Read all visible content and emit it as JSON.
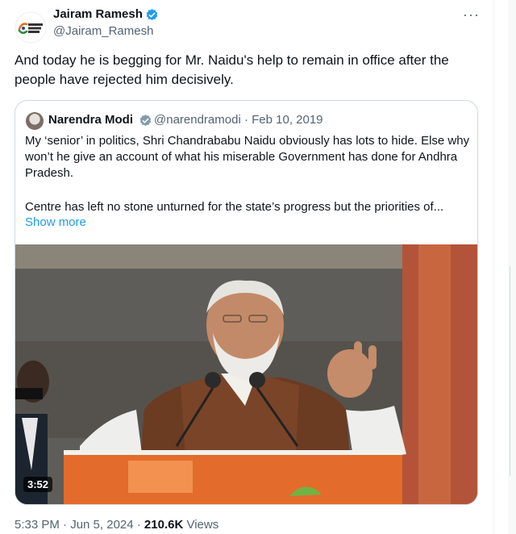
{
  "author": {
    "name": "Jairam Ramesh",
    "handle": "@Jairam_Ramesh",
    "avatar_text": "BHARAT JODO NYAY YATRA"
  },
  "more_label": "···",
  "tweet_text": "And today he is begging for Mr. Naidu's help to remain in office after the people have rejected him decisively.",
  "quote": {
    "name": "Narendra Modi",
    "meta": "@narendramodi · Feb 10, 2019",
    "text_1": "My ‘senior’ in politics, Shri Chandrababu Naidu obviously has lots to hide. Else why won’t he give an account of what his miserable Government has done for Andhra Pradesh.",
    "text_2": "Centre has left no stone unturned for the state’s progress but the priorities of...",
    "show_more": "Show more"
  },
  "video": {
    "duration": "3:52"
  },
  "footer": {
    "time_date": "5:33 PM · Jun 5, 2024 · ",
    "views_count": "210.6K",
    "views_label": " Views"
  },
  "colors": {
    "verified_blue": "#1d9bf0",
    "link_blue": "#1d9bf0",
    "secondary_text": "#536471"
  }
}
